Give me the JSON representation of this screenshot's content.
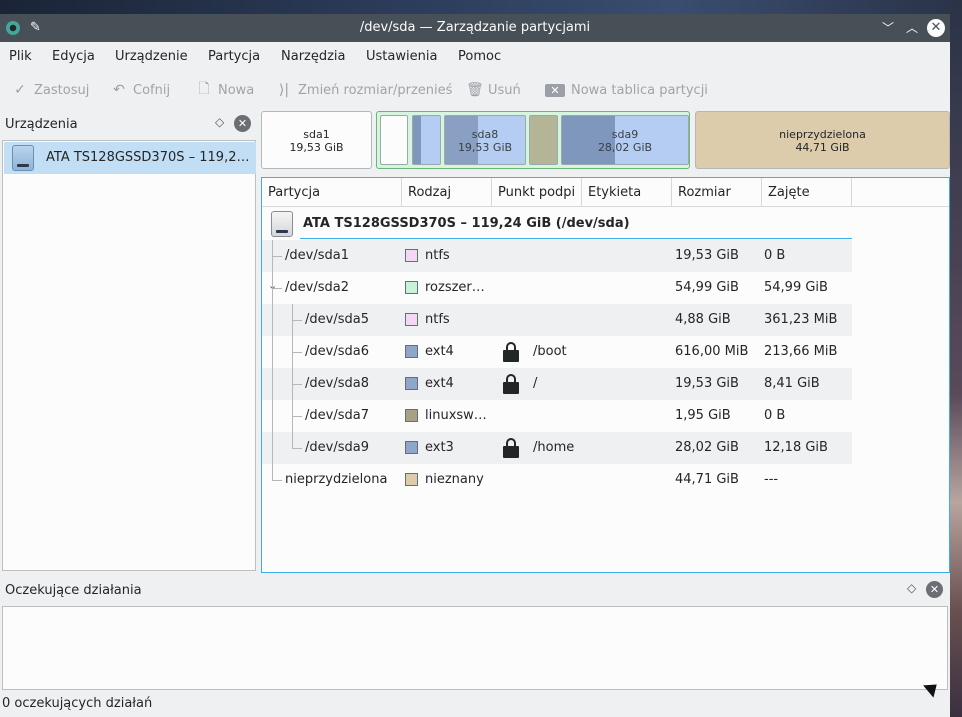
{
  "window": {
    "title": "/dev/sda — Zarządzanie partycjami"
  },
  "menu": [
    "Plik",
    "Edycja",
    "Urządzenie",
    "Partycja",
    "Narzędzia",
    "Ustawienia",
    "Pomoc"
  ],
  "toolbar": {
    "apply": "Zastosuj",
    "undo": "Cofnij",
    "new": "Nowa",
    "resize": "Zmień rozmiar/przenieś",
    "delete": "Usuń",
    "new_table": "Nowa tablica partycji"
  },
  "devices_panel": {
    "title": "Urządzenia",
    "items": [
      {
        "label": "ATA TS128GSSD370S – 119,24 GiB (/dev/sda)"
      }
    ]
  },
  "partition_bar": {
    "sda1": {
      "name": "sda1",
      "size": "19,53 GiB"
    },
    "sda8": {
      "name": "sda8",
      "size": "19,53 GiB"
    },
    "sda9": {
      "name": "sda9",
      "size": "28,02 GiB"
    },
    "unallocated": {
      "name": "nieprzydzielona",
      "size": "44,71 GiB"
    }
  },
  "table": {
    "columns": [
      "Partycja",
      "Rodzaj",
      "Punkt podpi",
      "Etykieta",
      "Rozmiar",
      "Zajęte"
    ],
    "disk_title": "ATA TS128GSSD370S – 119,24 GiB (/dev/sda)",
    "rows": [
      {
        "partition": "/dev/sda1",
        "type": "ntfs",
        "color": "#f3d8f6",
        "mount": "",
        "label": "",
        "size": "19,53 GiB",
        "used": "0 B",
        "locked": false
      },
      {
        "partition": "/dev/sda2",
        "type": "rozszer…",
        "color": "#c9f2d6",
        "mount": "",
        "label": "",
        "size": "54,99 GiB",
        "used": "54,99 GiB",
        "locked": false
      },
      {
        "partition": "/dev/sda5",
        "type": "ntfs",
        "color": "#f3d8f6",
        "mount": "",
        "label": "",
        "size": "4,88 GiB",
        "used": "361,23 MiB",
        "locked": false
      },
      {
        "partition": "/dev/sda6",
        "type": "ext4",
        "color": "#8fa6c9",
        "mount": "/boot",
        "label": "",
        "size": "616,00 MiB",
        "used": "213,66 MiB",
        "locked": true
      },
      {
        "partition": "/dev/sda8",
        "type": "ext4",
        "color": "#8fa6c9",
        "mount": "/",
        "label": "",
        "size": "19,53 GiB",
        "used": "8,41 GiB",
        "locked": true
      },
      {
        "partition": "/dev/sda7",
        "type": "linuxsw…",
        "color": "#a5a383",
        "mount": "",
        "label": "",
        "size": "1,95 GiB",
        "used": "0 B",
        "locked": false
      },
      {
        "partition": "/dev/sda9",
        "type": "ext3",
        "color": "#8fa6c9",
        "mount": "/home",
        "label": "",
        "size": "28,02 GiB",
        "used": "12,18 GiB",
        "locked": true
      },
      {
        "partition": "nieprzydzielona",
        "type": "nieznany",
        "color": "#dcccab",
        "mount": "",
        "label": "",
        "size": "44,71 GiB",
        "used": "---",
        "locked": false
      }
    ]
  },
  "pending_panel": {
    "title": "Oczekujące działania"
  },
  "status": "0 oczekujących działań"
}
